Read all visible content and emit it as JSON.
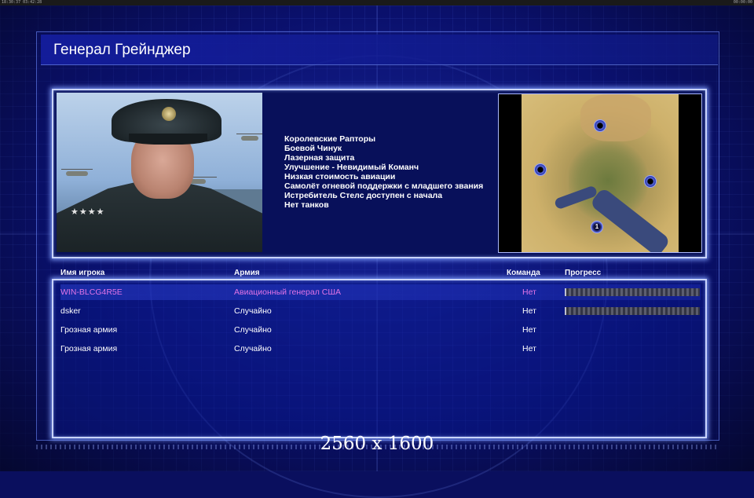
{
  "overlay": {
    "clock_left": "18:30:37 03:42:28",
    "clock_right": "00:00:00"
  },
  "general": {
    "name": "Генерал Грейнджер",
    "abilities": [
      "Королевские Рапторы",
      "Боевой Чинук",
      "Лазерная защита",
      "Улучшение - Невидимый Команч",
      "Низкая стоимость авиации",
      "Самолёт огневой поддержки с младшего звания",
      "Истребитель Стелс доступен с начала",
      "Нет танков"
    ]
  },
  "map": {
    "spawn_labels": [
      "",
      "",
      "",
      "1"
    ]
  },
  "table": {
    "headers": {
      "player": "Имя игрока",
      "army": "Армия",
      "team": "Команда",
      "progress": "Прогресс"
    },
    "rows": [
      {
        "name": "WIN-BLCG4R5E",
        "army": "Авиационный генерал США",
        "team": "Нет",
        "selected": true,
        "has_progress": true
      },
      {
        "name": "dsker",
        "army": "Случайно",
        "team": "Нет",
        "selected": false,
        "has_progress": true
      },
      {
        "name": "Грозная армия",
        "army": "Случайно",
        "team": "Нет",
        "selected": false,
        "has_progress": false
      },
      {
        "name": "Грозная армия",
        "army": "Случайно",
        "team": "Нет",
        "selected": false,
        "has_progress": false
      }
    ]
  },
  "resolution": "2560 x 1600",
  "colors": {
    "background": "#0a0f5e",
    "selected_text": "#e274e6",
    "panel_border": "#c9d4ff"
  }
}
